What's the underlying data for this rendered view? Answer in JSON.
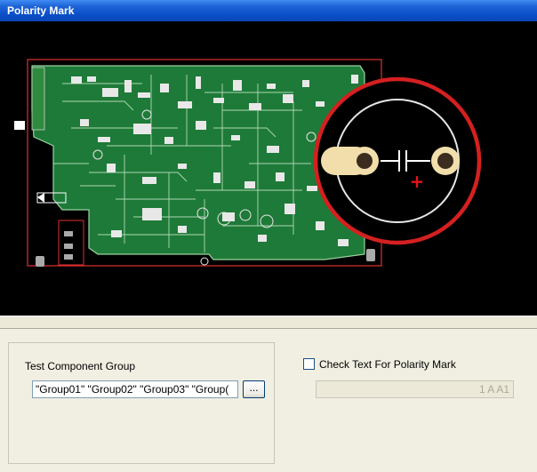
{
  "window": {
    "title": "Polarity Mark"
  },
  "preview": {
    "board_color": "#1E7A38",
    "outline_color": "#E03030",
    "zoom_ring_color": "#D42020",
    "component_symbol": "capacitor-icon",
    "polarity_glyph": "+"
  },
  "test_component_group": {
    "label": "Test Component Group",
    "value": "\"Group01\" \"Group02\" \"Group03\" \"Group(",
    "browse_label": "..."
  },
  "check_text": {
    "label": "Check Text For Polarity Mark",
    "checked": false,
    "value": "1 A A1"
  }
}
